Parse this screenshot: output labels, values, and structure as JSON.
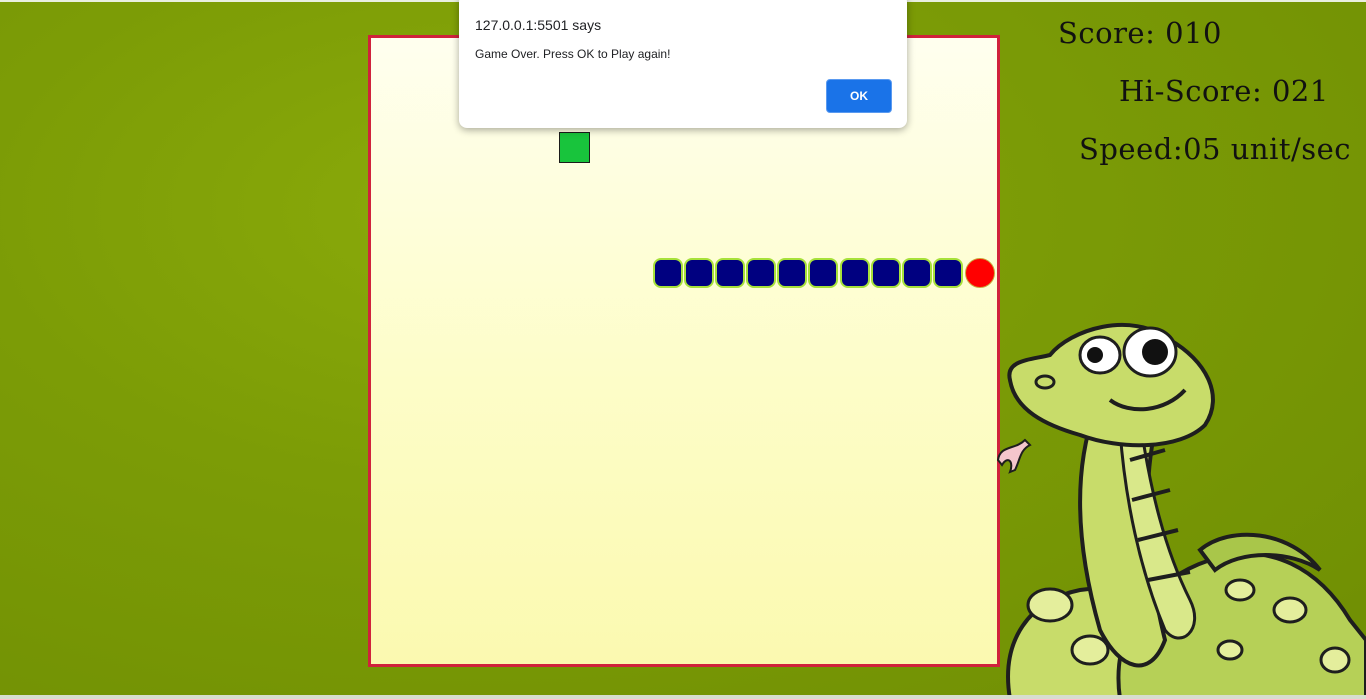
{
  "dialog": {
    "origin": "127.0.0.1:5501 says",
    "message": "Game Over. Press OK to Play again!",
    "ok_label": "OK"
  },
  "stats": {
    "score": "Score: 010",
    "hiscore": "Hi-Score: 021",
    "speed": "Speed:05 unit/sec"
  },
  "game": {
    "snake_body_segments": 10,
    "snake_body_color": "#000080",
    "snake_head_color": "#ff0000",
    "food_color": "#18c43c",
    "board_border_color": "#d0223c"
  },
  "icons": {
    "mascot": "cartoon-snake-mascot"
  }
}
